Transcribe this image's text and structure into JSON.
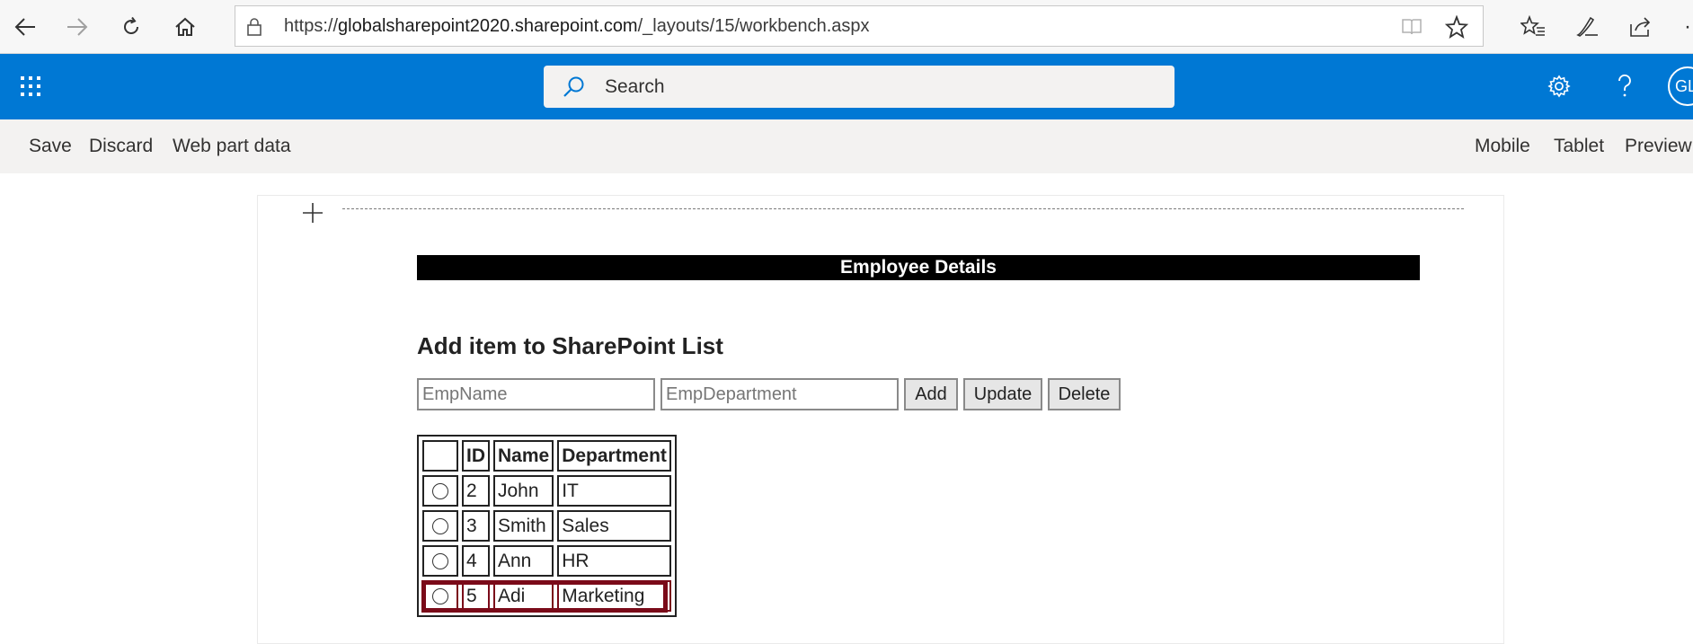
{
  "browser": {
    "url_prefix": "https://",
    "url_host": "globalsharepoint2020.sharepoint.com",
    "url_path": "/_layouts/15/workbench.aspx",
    "more_label": "·"
  },
  "suite": {
    "search_placeholder": "Search",
    "avatar_initials": "GL",
    "accent_color": "#0078d4"
  },
  "commands": {
    "save": "Save",
    "discard": "Discard",
    "web_part_data": "Web part data",
    "mobile": "Mobile",
    "tablet": "Tablet",
    "preview": "Preview"
  },
  "webpart": {
    "header": "Employee Details",
    "title": "Add item to SharePoint List",
    "emp_name_placeholder": "EmpName",
    "emp_department_placeholder": "EmpDepartment",
    "add_label": "Add",
    "update_label": "Update",
    "delete_label": "Delete"
  },
  "table": {
    "columns": [
      "",
      "ID",
      "Name",
      "Department"
    ],
    "rows": [
      {
        "id": "2",
        "name": "John",
        "department": "IT"
      },
      {
        "id": "3",
        "name": "Smith",
        "department": "Sales"
      },
      {
        "id": "4",
        "name": "Ann",
        "department": "HR"
      },
      {
        "id": "5",
        "name": "Adi",
        "department": "Marketing"
      }
    ],
    "highlight_color": "#7a0a19"
  }
}
